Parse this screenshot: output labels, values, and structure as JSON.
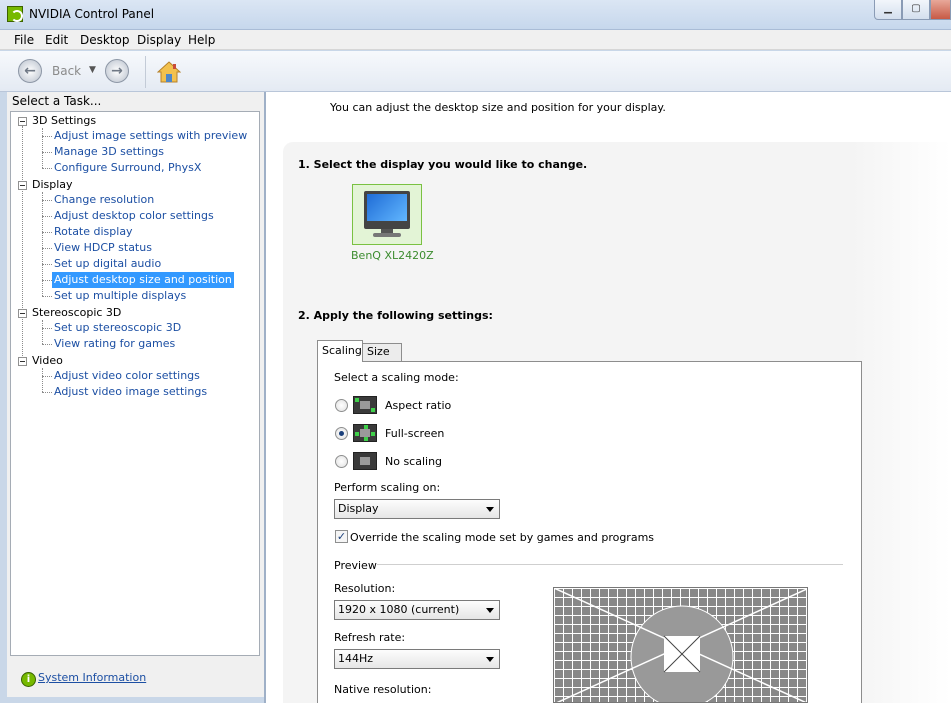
{
  "window": {
    "title": "NVIDIA Control Panel"
  },
  "menu": [
    "File",
    "Edit",
    "Desktop",
    "Display",
    "Help"
  ],
  "toolbar": {
    "back_label": "Back"
  },
  "left": {
    "header": "Select a Task...",
    "categories": [
      {
        "label": "3D Settings",
        "tasks": [
          "Adjust image settings with preview",
          "Manage 3D settings",
          "Configure Surround, PhysX"
        ]
      },
      {
        "label": "Display",
        "tasks": [
          "Change resolution",
          "Adjust desktop color settings",
          "Rotate display",
          "View HDCP status",
          "Set up digital audio",
          "Adjust desktop size and position",
          "Set up multiple displays"
        ]
      },
      {
        "label": "Stereoscopic 3D",
        "tasks": [
          "Set up stereoscopic 3D",
          "View rating for games"
        ]
      },
      {
        "label": "Video",
        "tasks": [
          "Adjust video color settings",
          "Adjust video image settings"
        ]
      }
    ],
    "selected_task": "Adjust desktop size and position",
    "system_info": "System Information"
  },
  "main": {
    "intro": "You can adjust the desktop size and position for your display.",
    "step1": "1. Select the display you would like to change.",
    "display_name": "BenQ XL2420Z",
    "step2": "2. Apply the following settings:",
    "tabs": [
      "Scaling",
      "Size"
    ],
    "scaling_mode_label": "Select a scaling mode:",
    "modes": [
      "Aspect ratio",
      "Full-screen",
      "No scaling"
    ],
    "selected_mode": "Full-screen",
    "perform_label": "Perform scaling on:",
    "perform_value": "Display",
    "override_label": "Override the scaling mode set by games and programs",
    "override_checked": true,
    "preview_label": "Preview",
    "resolution_label": "Resolution:",
    "resolution_value": "1920 x 1080 (current)",
    "refresh_label": "Refresh rate:",
    "refresh_value": "144Hz",
    "native_label": "Native resolution:"
  },
  "colors": {
    "nvidia_green": "#76b900",
    "link_blue": "#1c4fa3",
    "selection": "#3399ff"
  }
}
